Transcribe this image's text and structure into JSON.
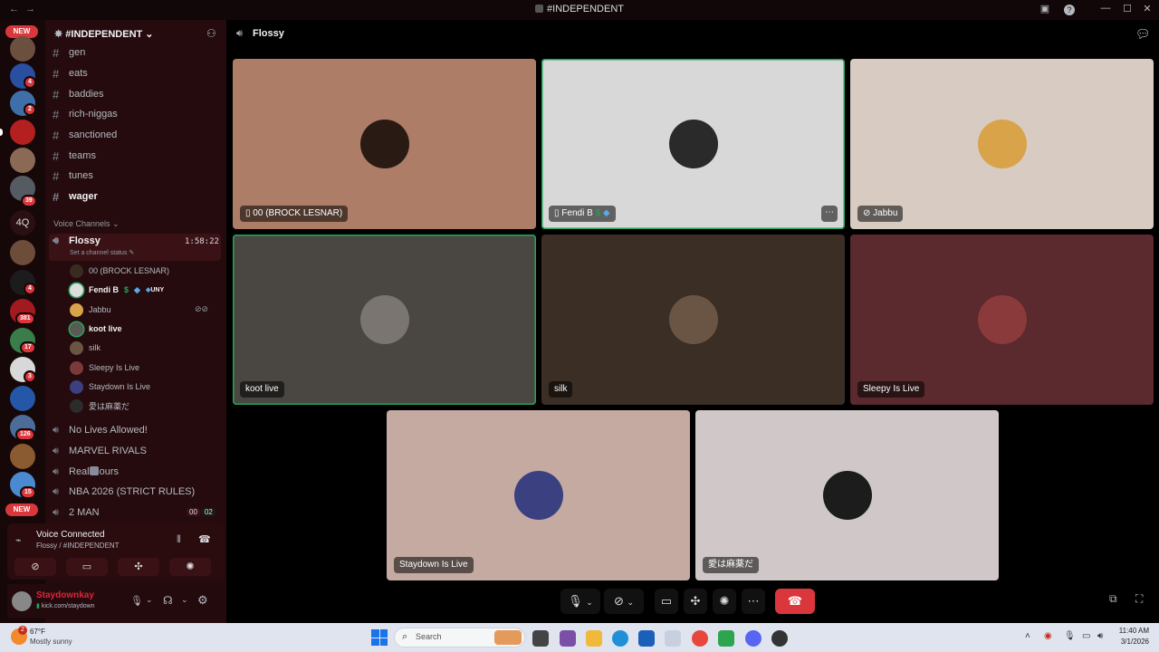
{
  "window": {
    "title": "#INDEPENDENT"
  },
  "rail": {
    "new_top": "NEW",
    "new_bottom": "NEW",
    "badges": [
      "4",
      "2",
      "39",
      "4",
      "381",
      "17",
      "3",
      "126",
      "15"
    ],
    "text_server": "4Q"
  },
  "server": {
    "name": "#INDEPENDENT"
  },
  "channels": [
    "gen",
    "eats",
    "baddies",
    "rich-niggas",
    "sanctioned",
    "teams",
    "tunes",
    "wager"
  ],
  "voice_section": "Voice Channels",
  "current_voice": {
    "name": "Flossy",
    "time": "1:58:22",
    "status_hint": "Set a channel status"
  },
  "members": [
    "00 (BROCK LESNAR)",
    "Fendi B",
    "Jabbu",
    "koot live",
    "silk",
    "Sleepy Is Live",
    "Staydown Is Live",
    "愛は麻薬だ"
  ],
  "member_extra": {
    "fendi_tag": "UNY"
  },
  "other_voice": [
    "No Lives Allowed!",
    "MARVEL RIVALS",
    "Real  Hours",
    "NBA 2026 (STRICT RULES)",
    "2 MAN"
  ],
  "two_man_counts": [
    "00",
    "02"
  ],
  "voice_panel": {
    "status": "Voice Connected",
    "location": "Flossy / #INDEPENDENT"
  },
  "user": {
    "name": "Staydownkay",
    "sub": "kick.com/staydown"
  },
  "main": {
    "channel": "Flossy"
  },
  "tiles": [
    {
      "name": "00 (BROCK LESNAR)"
    },
    {
      "name": "Fendi B"
    },
    {
      "name": "Jabbu"
    },
    {
      "name": "koot live"
    },
    {
      "name": "silk"
    },
    {
      "name": "Sleepy Is Live"
    },
    {
      "name": "Staydown Is Live"
    },
    {
      "name": "愛は麻薬だ"
    }
  ],
  "taskbar": {
    "weather_temp": "67°F",
    "weather_desc": "Mostly sunny",
    "search": "Search",
    "time": "11:40 AM",
    "date": "3/1/2026",
    "weather_badge": "2"
  },
  "colors": {
    "speaking": "#23a55a",
    "danger": "#da373c"
  }
}
